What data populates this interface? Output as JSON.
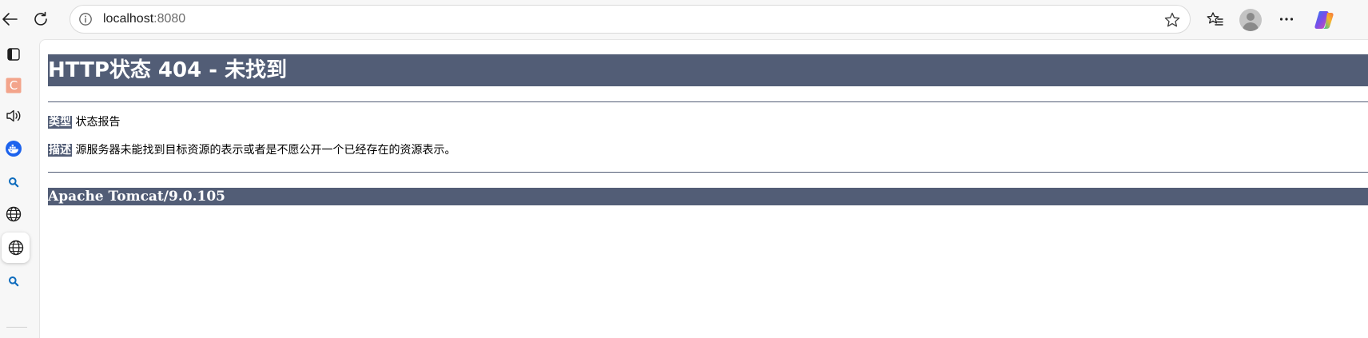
{
  "browser": {
    "address": {
      "host": "localhost",
      "port": ":8080"
    },
    "icons": {
      "back": "back-arrow-icon",
      "refresh": "refresh-icon",
      "site_info": "info-icon",
      "favorite": "star-icon",
      "favorites": "favorites-icon",
      "profile": "profile-avatar",
      "more": "more-icon",
      "copilot": "copilot-icon"
    },
    "sidebar": {
      "items": [
        {
          "name": "tab-actions-icon"
        },
        {
          "name": "c-app-icon",
          "letter": "C",
          "color": "#f3a48b"
        },
        {
          "name": "read-aloud-icon"
        },
        {
          "name": "docker-whale-icon",
          "color": "#1d63ed"
        },
        {
          "name": "search-icon",
          "color": "#0f6cbd"
        },
        {
          "name": "globe-icon"
        },
        {
          "name": "globe-icon-active"
        },
        {
          "name": "search-icon-2",
          "color": "#0f6cbd"
        }
      ]
    }
  },
  "page": {
    "title": "HTTP状态 404 - 未找到",
    "type_label": "类型",
    "type_value": "状态报告",
    "desc_label": "描述",
    "desc_value": "源服务器未能找到目标资源的表示或者是不愿公开一个已经存在的资源表示。",
    "footer": "Apache Tomcat/9.0.105"
  },
  "colors": {
    "tomcat_header": "#525d76",
    "toolbar_bg": "#f7f7f7"
  }
}
